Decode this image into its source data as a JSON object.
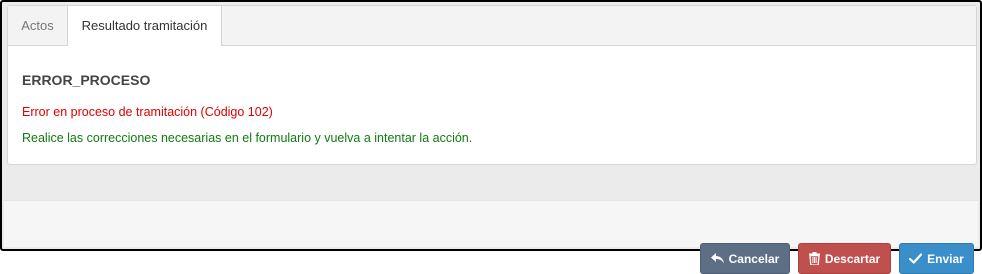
{
  "tabs": [
    {
      "label": "Actos",
      "active": false
    },
    {
      "label": "Resultado tramitación",
      "active": true
    }
  ],
  "result": {
    "title": "ERROR_PROCESO",
    "error_message": "Error en proceso de tramitación (Código 102)",
    "info_message": "Realice las correcciones necesarias en el formulario y vuelva a intentar la acción."
  },
  "footer": {
    "cancel_label": "Cancelar",
    "discard_label": "Descartar",
    "send_label": "Enviar"
  },
  "colors": {
    "error": "#e00000",
    "info": "#117a11",
    "cancel": "#5d6f85",
    "discard": "#c0504d",
    "send": "#3a8ec9"
  },
  "icons": {
    "cancel": "reply-arrow-icon",
    "discard": "trash-icon",
    "send": "check-icon"
  }
}
